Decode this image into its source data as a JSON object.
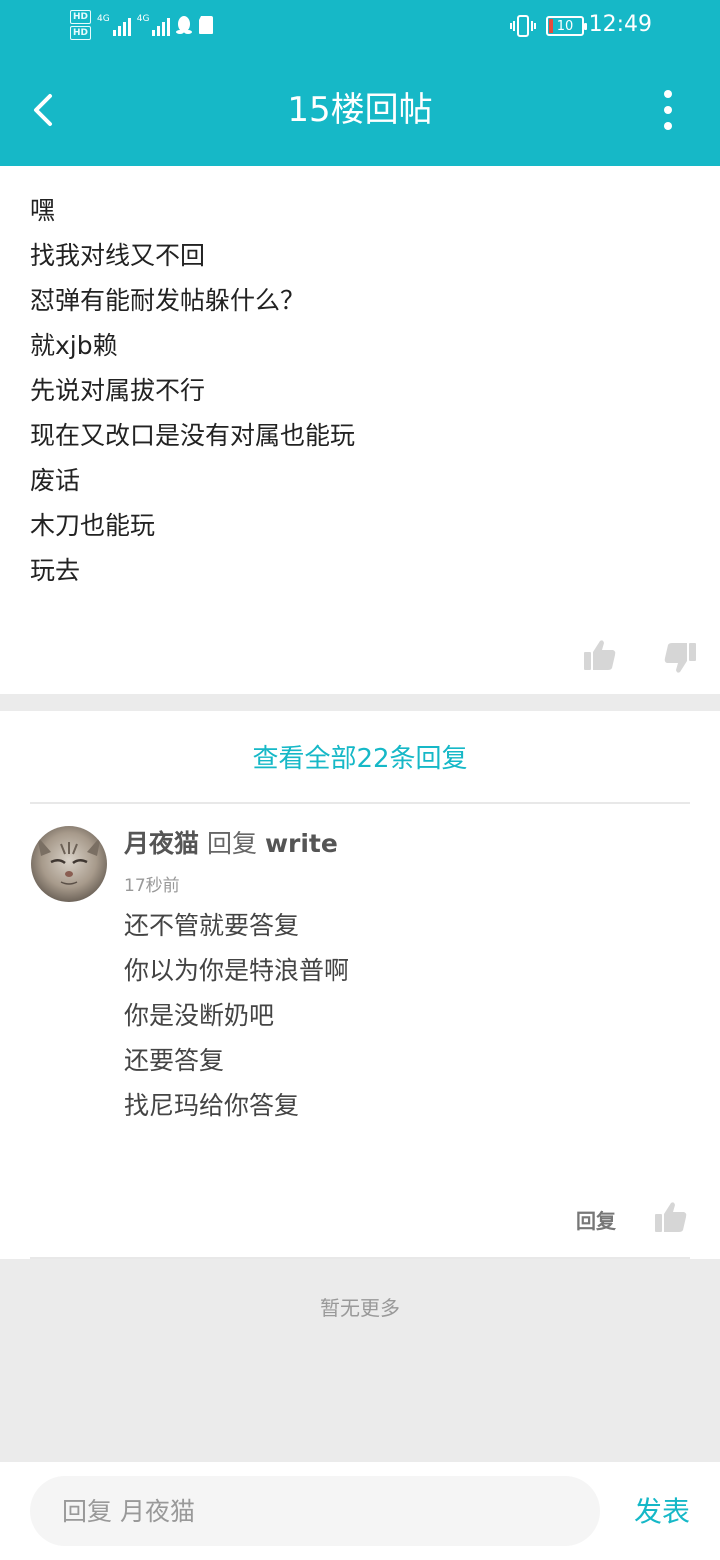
{
  "status_bar": {
    "hd1": "HD",
    "hd2": "HD",
    "sig1_label": "4G",
    "sig2_label": "4G",
    "battery_level": "10",
    "time": "12:49"
  },
  "header": {
    "title": "15楼回帖"
  },
  "post": {
    "lines": [
      "嘿",
      "找我对线又不回",
      "怼弹有能耐发帖躲什么？",
      "就xjb赖",
      "先说对属拔不行",
      "现在又改口是没有对属也能玩",
      "废话",
      "木刀也能玩",
      "玩去"
    ]
  },
  "replies": {
    "view_all_label": "查看全部22条回复",
    "items": [
      {
        "author": "月夜猫",
        "reply_word": "回复",
        "target": "write",
        "time": "17秒前",
        "lines": [
          "还不管就要答复",
          "你以为你是特浪普啊",
          "你是没断奶吧",
          "还要答复",
          "找尼玛给你答复"
        ],
        "reply_label": "回复"
      }
    ]
  },
  "footer": {
    "no_more": "暂无更多"
  },
  "bottom_bar": {
    "input_placeholder": "回复 月夜猫",
    "send_label": "发表"
  },
  "colors": {
    "accent": "#16b8c7",
    "background": "#ebebeb"
  }
}
